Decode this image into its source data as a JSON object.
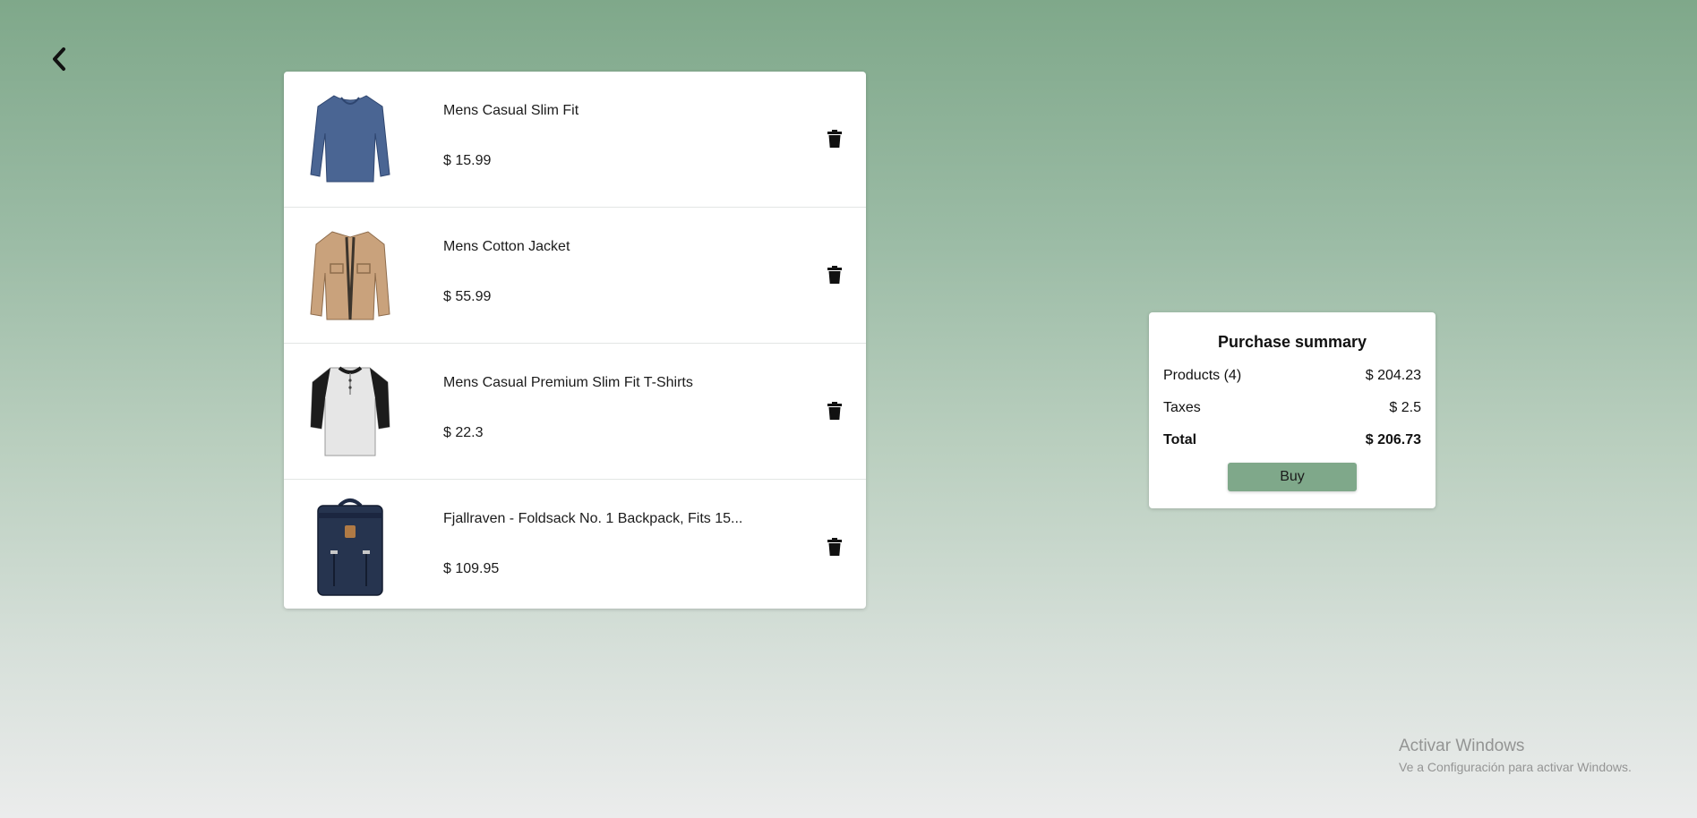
{
  "navigation": {
    "back_icon": "chevron-left-icon"
  },
  "cart": {
    "items": [
      {
        "title": "Mens Casual Slim Fit",
        "price": "$ 15.99",
        "image": "blue-long-sleeve-shirt",
        "delete_icon": "trash-icon"
      },
      {
        "title": "Mens Cotton Jacket",
        "price": "$ 55.99",
        "image": "tan-cotton-jacket",
        "delete_icon": "trash-icon"
      },
      {
        "title": "Mens Casual Premium Slim Fit T-Shirts",
        "price": "$ 22.3",
        "image": "raglan-henley-shirt",
        "delete_icon": "trash-icon"
      },
      {
        "title": "Fjallraven - Foldsack No. 1 Backpack, Fits 15...",
        "price": "$ 109.95",
        "image": "navy-backpack",
        "delete_icon": "trash-icon"
      }
    ]
  },
  "summary": {
    "title": "Purchase summary",
    "products_label": "Products (4)",
    "products_value": "$ 204.23",
    "taxes_label": "Taxes",
    "taxes_value": "$ 2.5",
    "total_label": "Total",
    "total_value": "$ 206.73",
    "buy_label": "Buy"
  },
  "watermark": {
    "title": "Activar Windows",
    "subtitle": "Ve a Configuración para activar Windows."
  },
  "colors": {
    "accent": "#7fa88a",
    "background_top": "#7fa88a",
    "background_bottom": "#ebecec"
  }
}
